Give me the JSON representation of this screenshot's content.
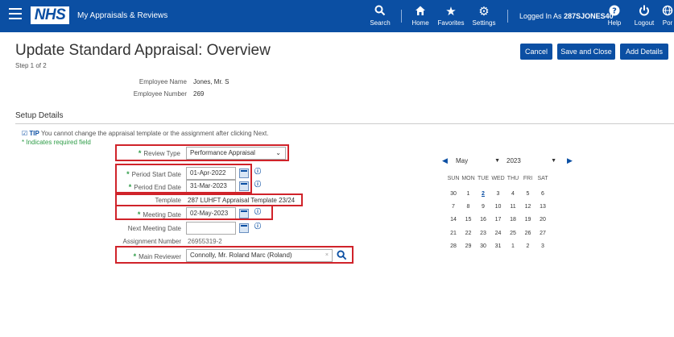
{
  "header": {
    "logo_text": "NHS",
    "app_title": "My Appraisals & Reviews",
    "items": [
      {
        "label": "Search",
        "icon": "search-icon"
      },
      {
        "label": "Home",
        "icon": "home-icon"
      },
      {
        "label": "Favorites",
        "icon": "star-icon"
      },
      {
        "label": "Settings",
        "icon": "gear-icon"
      },
      {
        "label": "Help",
        "icon": "help-icon"
      },
      {
        "label": "Logout",
        "icon": "power-icon"
      },
      {
        "label": "Por",
        "icon": "globe-icon"
      }
    ],
    "logged_prefix": "Logged In As",
    "logged_user": "287SJONES40"
  },
  "page": {
    "title": "Update Standard Appraisal: Overview",
    "step": "Step 1 of 2",
    "buttons": {
      "cancel": "Cancel",
      "save_close": "Save and Close",
      "add_details": "Add Details"
    }
  },
  "employee": {
    "name_label": "Employee Name",
    "name_value": "Jones, Mr. S",
    "number_label": "Employee Number",
    "number_value": "269"
  },
  "setup": {
    "section_title": "Setup Details",
    "tip_label": "TIP",
    "tip_text": "You cannot change the appraisal template or the assignment after clicking Next.",
    "required_note": "* Indicates required field",
    "review_type_label": "Review Type",
    "review_type_value": "Performance Appraisal",
    "period_start_label": "Period Start Date",
    "period_start_value": "01-Apr-2022",
    "period_end_label": "Period End Date",
    "period_end_value": "31-Mar-2023",
    "template_label": "Template",
    "template_value": "287 LUHFT Appraisal Template 23/24",
    "meeting_date_label": "Meeting Date",
    "meeting_date_value": "02-May-2023",
    "next_meeting_label": "Next Meeting Date",
    "next_meeting_value": "",
    "assignment_label": "Assignment Number",
    "assignment_value": "26955319-2",
    "main_reviewer_label": "Main Reviewer",
    "main_reviewer_value": "Connolly, Mr. Roland Marc (Roland)"
  },
  "calendar": {
    "month": "May",
    "year": "2023",
    "weekdays": [
      "SUN",
      "MON",
      "TUE",
      "WED",
      "THU",
      "FRI",
      "SAT"
    ],
    "weeks": [
      [
        "30",
        "1",
        "2",
        "3",
        "4",
        "5",
        "6"
      ],
      [
        "7",
        "8",
        "9",
        "10",
        "11",
        "12",
        "13"
      ],
      [
        "14",
        "15",
        "16",
        "17",
        "18",
        "19",
        "20"
      ],
      [
        "21",
        "22",
        "23",
        "24",
        "25",
        "26",
        "27"
      ],
      [
        "28",
        "29",
        "30",
        "31",
        "1",
        "2",
        "3"
      ]
    ],
    "today": "2"
  },
  "colors": {
    "brand": "#0b4fa3",
    "highlight": "#d0232a",
    "required": "#2e9c47"
  }
}
